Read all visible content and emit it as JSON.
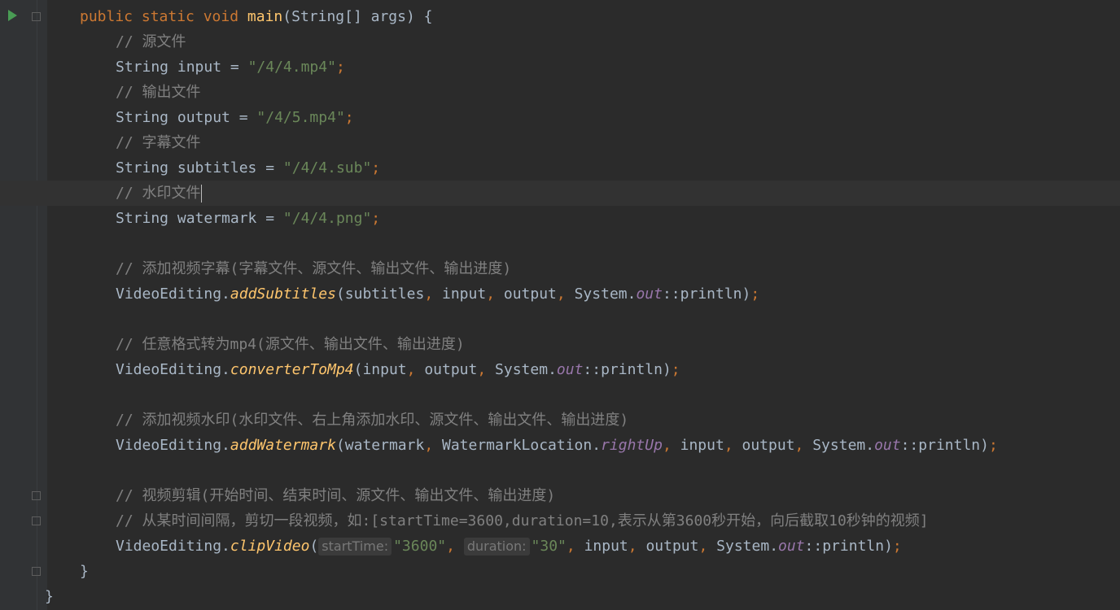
{
  "editor": {
    "lines": [
      {
        "id": "l1"
      },
      {
        "id": "l2",
        "comment": "// 源文件"
      },
      {
        "id": "l3",
        "var": "input",
        "value": "\"/4/4.mp4\""
      },
      {
        "id": "l4",
        "comment": "// 输出文件"
      },
      {
        "id": "l5",
        "var": "output",
        "value": "\"/4/5.mp4\""
      },
      {
        "id": "l6",
        "comment": "// 字幕文件"
      },
      {
        "id": "l7",
        "var": "subtitles",
        "value": "\"/4/4.sub\""
      },
      {
        "id": "l8",
        "comment": "// 水印文件"
      },
      {
        "id": "l9",
        "var": "watermark",
        "value": "\"/4/4.png\""
      },
      {
        "id": "l11",
        "comment": "// 添加视频字幕(字幕文件、源文件、输出文件、输出进度)"
      },
      {
        "id": "l12",
        "method": "addSubtitles"
      },
      {
        "id": "l14",
        "comment": "// 任意格式转为mp4(源文件、输出文件、输出进度)"
      },
      {
        "id": "l15",
        "method": "converterToMp4"
      },
      {
        "id": "l17",
        "comment": "// 添加视频水印(水印文件、右上角添加水印、源文件、输出文件、输出进度)"
      },
      {
        "id": "l18",
        "method": "addWatermark"
      },
      {
        "id": "l20",
        "comment": "// 视频剪辑(开始时间、结束时间、源文件、输出文件、输出进度)"
      },
      {
        "id": "l21",
        "comment": "// 从某时间间隔，剪切一段视频，如:[startTime=3600,duration=10,表示从第3600秒开始，向后截取10秒钟的视频]"
      },
      {
        "id": "l22",
        "method": "clipVideo",
        "hint1": "startTime:",
        "arg1": "\"3600\"",
        "hint2": "duration:",
        "arg2": "\"30\""
      }
    ]
  },
  "colors": {
    "background": "#2b2b2b",
    "keyword": "#cc7832",
    "string": "#6a8759",
    "comment": "#808080",
    "method": "#ffc66d",
    "field": "#9876aa",
    "text": "#a9b7c6"
  },
  "icons": [
    "run-icon",
    "fold-icon",
    "intention-bulb-icon"
  ]
}
